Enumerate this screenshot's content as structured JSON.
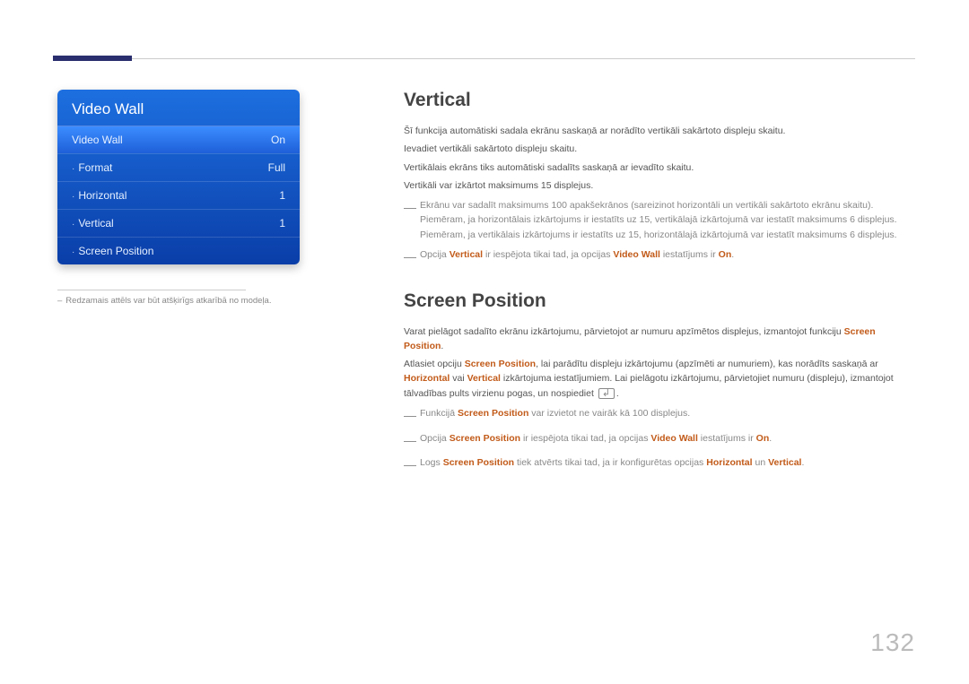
{
  "page_number": "132",
  "osd": {
    "title": "Video Wall",
    "rows": [
      {
        "label": "Video Wall",
        "value": "On",
        "bullet": ""
      },
      {
        "label": "Format",
        "value": "Full",
        "bullet": "·"
      },
      {
        "label": "Horizontal",
        "value": "1",
        "bullet": "·"
      },
      {
        "label": "Vertical",
        "value": "1",
        "bullet": "·"
      },
      {
        "label": "Screen Position",
        "value": "",
        "bullet": "·"
      }
    ]
  },
  "footnote": "Redzamais attēls var būt atšķirīgs atkarībā no modeļa.",
  "vertical": {
    "heading": "Vertical",
    "p1": "Šī funkcija automātiski sadala ekrānu saskaņā ar norādīto vertikāli sakārtoto displeju skaitu.",
    "p2": "Ievadiet vertikāli sakārtoto displeju skaitu.",
    "p3": "Vertikālais ekrāns tiks automātiski sadalīts saskaņā ar ievadīto skaitu.",
    "p4": "Vertikāli var izkārtot maksimums 15 displejus.",
    "note1": "Ekrānu var sadalīt maksimums 100 apakšekrānos (sareizinot horizontāli un vertikāli sakārtoto ekrānu skaitu). Piemēram, ja horizontālais izkārtojums ir iestatīts uz 15, vertikālajā izkārtojumā var iestatīt maksimums 6 displejus. Piemēram, ja vertikālais izkārtojums ir iestatīts uz 15, horizontālajā izkārtojumā var iestatīt maksimums 6 displejus.",
    "note2_pre": "Opcija ",
    "note2_b1": "Vertical",
    "note2_mid": " ir iespējota tikai tad, ja opcijas ",
    "note2_b2": "Video Wall",
    "note2_mid2": " iestatījums ir ",
    "note2_b3": "On",
    "note2_end": "."
  },
  "screenpos": {
    "heading": "Screen Position",
    "p1_pre": "Varat pielāgot sadalīto ekrānu izkārtojumu, pārvietojot ar numuru apzīmētos displejus, izmantojot funkciju ",
    "p1_b": "Screen Position",
    "p1_end": ".",
    "p2_pre": "Atlasiet opciju ",
    "p2_b1": "Screen Position",
    "p2_mid1": ", lai parādītu displeju izkārtojumu (apzīmēti ar numuriem), kas norādīts saskaņā ar ",
    "p2_b2": "Horizontal",
    "p2_mid2": " vai ",
    "p2_b3": "Vertical",
    "p2_mid3": " izkārtojuma iestatījumiem. Lai pielāgotu izkārtojumu, pārvietojiet numuru (displeju), izmantojot tālvadības pults virzienu pogas, un nospiediet ",
    "p2_end": ".",
    "note1_pre": "Funkcijā ",
    "note1_b": "Screen Position",
    "note1_end": " var izvietot ne vairāk kā 100 displejus.",
    "note2_pre": "Opcija ",
    "note2_b1": "Screen Position",
    "note2_mid": " ir iespējota tikai tad, ja opcijas ",
    "note2_b2": "Video Wall",
    "note2_mid2": " iestatījums ir ",
    "note2_b3": "On",
    "note2_end": ".",
    "note3_pre": "Logs ",
    "note3_b1": "Screen Position",
    "note3_mid": " tiek atvērts tikai tad, ja ir konfigurētas opcijas ",
    "note3_b2": "Horizontal",
    "note3_mid2": " un ",
    "note3_b3": "Vertical",
    "note3_end": "."
  }
}
